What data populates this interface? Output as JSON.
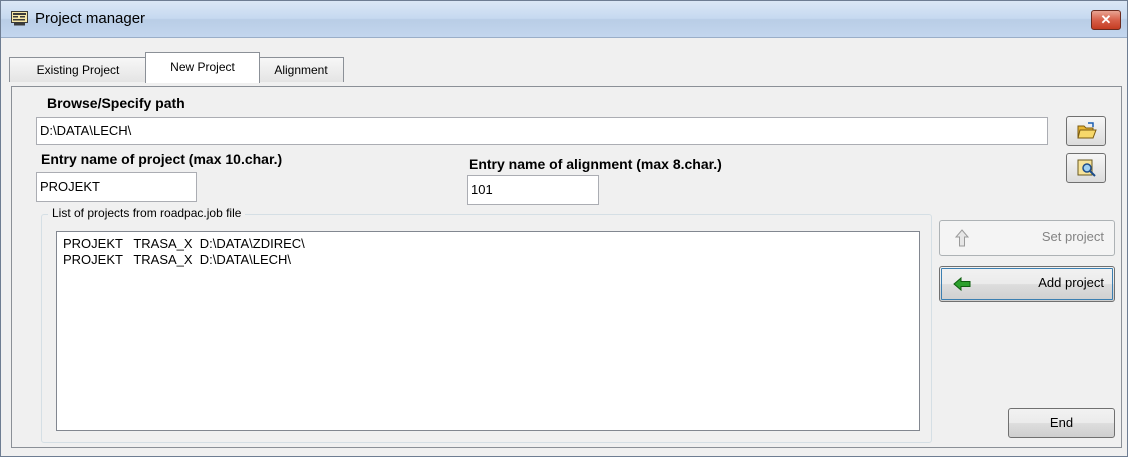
{
  "window": {
    "title": "Project manager",
    "close_label": "✕"
  },
  "tabs": [
    {
      "label": "Existing Project"
    },
    {
      "label": "New Project"
    },
    {
      "label": "Alignment"
    }
  ],
  "browse": {
    "label": "Browse/Specify path",
    "path_value": "D:\\DATA\\LECH\\"
  },
  "project_name": {
    "label": "Entry name of project (max 10.char.)",
    "value": "PROJEKT"
  },
  "alignment_name": {
    "label": "Entry name of alignment (max 8.char.)",
    "value": "101"
  },
  "project_list": {
    "caption": "List of projects from roadpac.job file",
    "items": [
      "PROJEKT   TRASA_X  D:\\DATA\\ZDIREC\\",
      "PROJEKT   TRASA_X  D:\\DATA\\LECH\\"
    ]
  },
  "buttons": {
    "set_project": "Set project",
    "add_project": "Add project",
    "end": "End"
  },
  "icons": {
    "title": "project-manager-icon",
    "browse": "open-folder-icon",
    "search": "search-document-icon",
    "set": "up-arrow-icon",
    "add": "left-arrow-icon"
  },
  "colors": {
    "add_arrow": "#2ca02c",
    "folder": "#e8b634"
  }
}
